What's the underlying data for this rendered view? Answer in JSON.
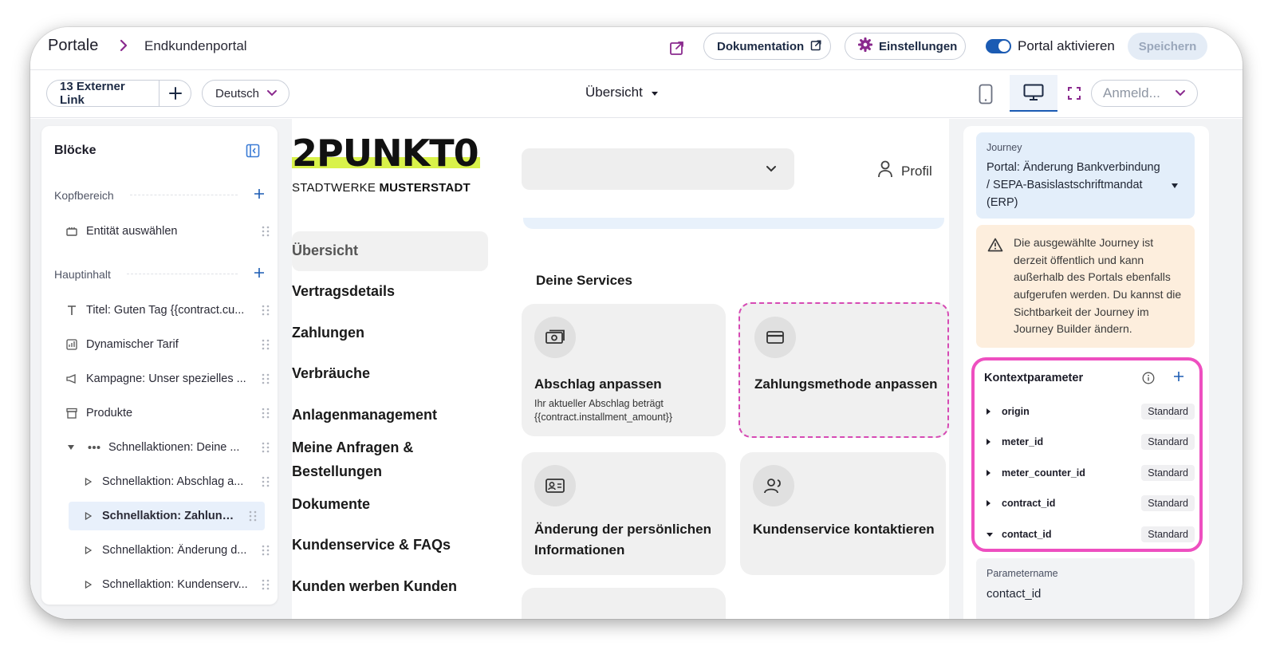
{
  "header": {
    "breadcrumb_root": "Portale",
    "breadcrumb_current": "Endkundenportal",
    "documentation_label": "Dokumentation",
    "settings_label": "Einstellungen",
    "activate_label": "Portal aktivieren",
    "activate_on": true,
    "save_label": "Speichern"
  },
  "toolbar": {
    "links_label": "13 Externer Link",
    "language": "Deutsch",
    "page": "Übersicht",
    "login_placeholder": "Anmeld..."
  },
  "blocks": {
    "title": "Blöcke",
    "sections": [
      {
        "title": "Kopfbereich"
      },
      {
        "title": "Hauptinhalt"
      }
    ],
    "header_items": [
      {
        "label": "Entität auswählen",
        "icon": "entity-icon"
      }
    ],
    "main_items": [
      {
        "label": "Titel: Guten Tag {{contract.cu...",
        "icon": "text-icon"
      },
      {
        "label": "Dynamischer Tarif",
        "icon": "tariff-icon"
      },
      {
        "label": "Kampagne: Unser spezielles ...",
        "icon": "megaphone-icon"
      },
      {
        "label": "Produkte",
        "icon": "box-icon"
      },
      {
        "label": "Schnellaktionen: Deine ...",
        "icon": "dots-icon"
      },
      {
        "label": "Schnellaktion: Abschlag a...",
        "icon": "triangle-icon"
      },
      {
        "label": "Schnellaktion: Zahlungsm...",
        "icon": "triangle-icon"
      },
      {
        "label": "Schnellaktion: Änderung d...",
        "icon": "triangle-icon"
      },
      {
        "label": "Schnellaktion: Kundenserv...",
        "icon": "triangle-icon"
      }
    ]
  },
  "preview": {
    "logo_main": "2PUNKT0",
    "logo_sub_plain": "STADTWERKE ",
    "logo_sub_bold": "MUSTERSTADT",
    "profile_label": "Profil",
    "nav": [
      "Übersicht",
      "Vertragsdetails",
      "Zahlungen",
      "Verbräuche",
      "Anlagenmanagement",
      "Meine Anfragen &",
      "Bestellungen",
      "Dokumente",
      "Kundenservice & FAQs",
      "Kunden werben Kunden"
    ],
    "services_title": "Deine Services",
    "cards": [
      {
        "title": "Abschlag anpassen",
        "sub1": "Ihr aktueller Abschlag beträgt",
        "sub2": "{{contract.installment_amount}}"
      },
      {
        "title": "Zahlungsmethode anpassen"
      },
      {
        "title1": "Änderung der persönlichen",
        "title2": "Informationen"
      },
      {
        "title": "Kundenservice kontaktieren"
      }
    ]
  },
  "right": {
    "journey_label": "Journey",
    "journey_value": "Portal: Änderung Bankverbindung / SEPA-Basislastschriftmandat (ERP)",
    "warning": "Die ausgewählte Journey ist derzeit öffentlich und kann außerhalb des Portals ebenfalls aufgerufen werden. Du kannst die Sichtbarkeit der Journey im Journey Builder ändern.",
    "ctx_title": "Kontextparameter",
    "params": [
      {
        "name": "origin",
        "badge": "Standard"
      },
      {
        "name": "meter_id",
        "badge": "Standard"
      },
      {
        "name": "meter_counter_id",
        "badge": "Standard"
      },
      {
        "name": "contract_id",
        "badge": "Standard"
      },
      {
        "name": "contact_id",
        "badge": "Standard"
      }
    ],
    "param_name_label": "Parametername",
    "param_name_value": "contact_id"
  },
  "colors": {
    "accent_blue": "#1b5bb3",
    "accent_purple": "#8a2a8e",
    "highlight_pink": "#ee4fc0",
    "logo_yellow": "#d9f24a"
  }
}
